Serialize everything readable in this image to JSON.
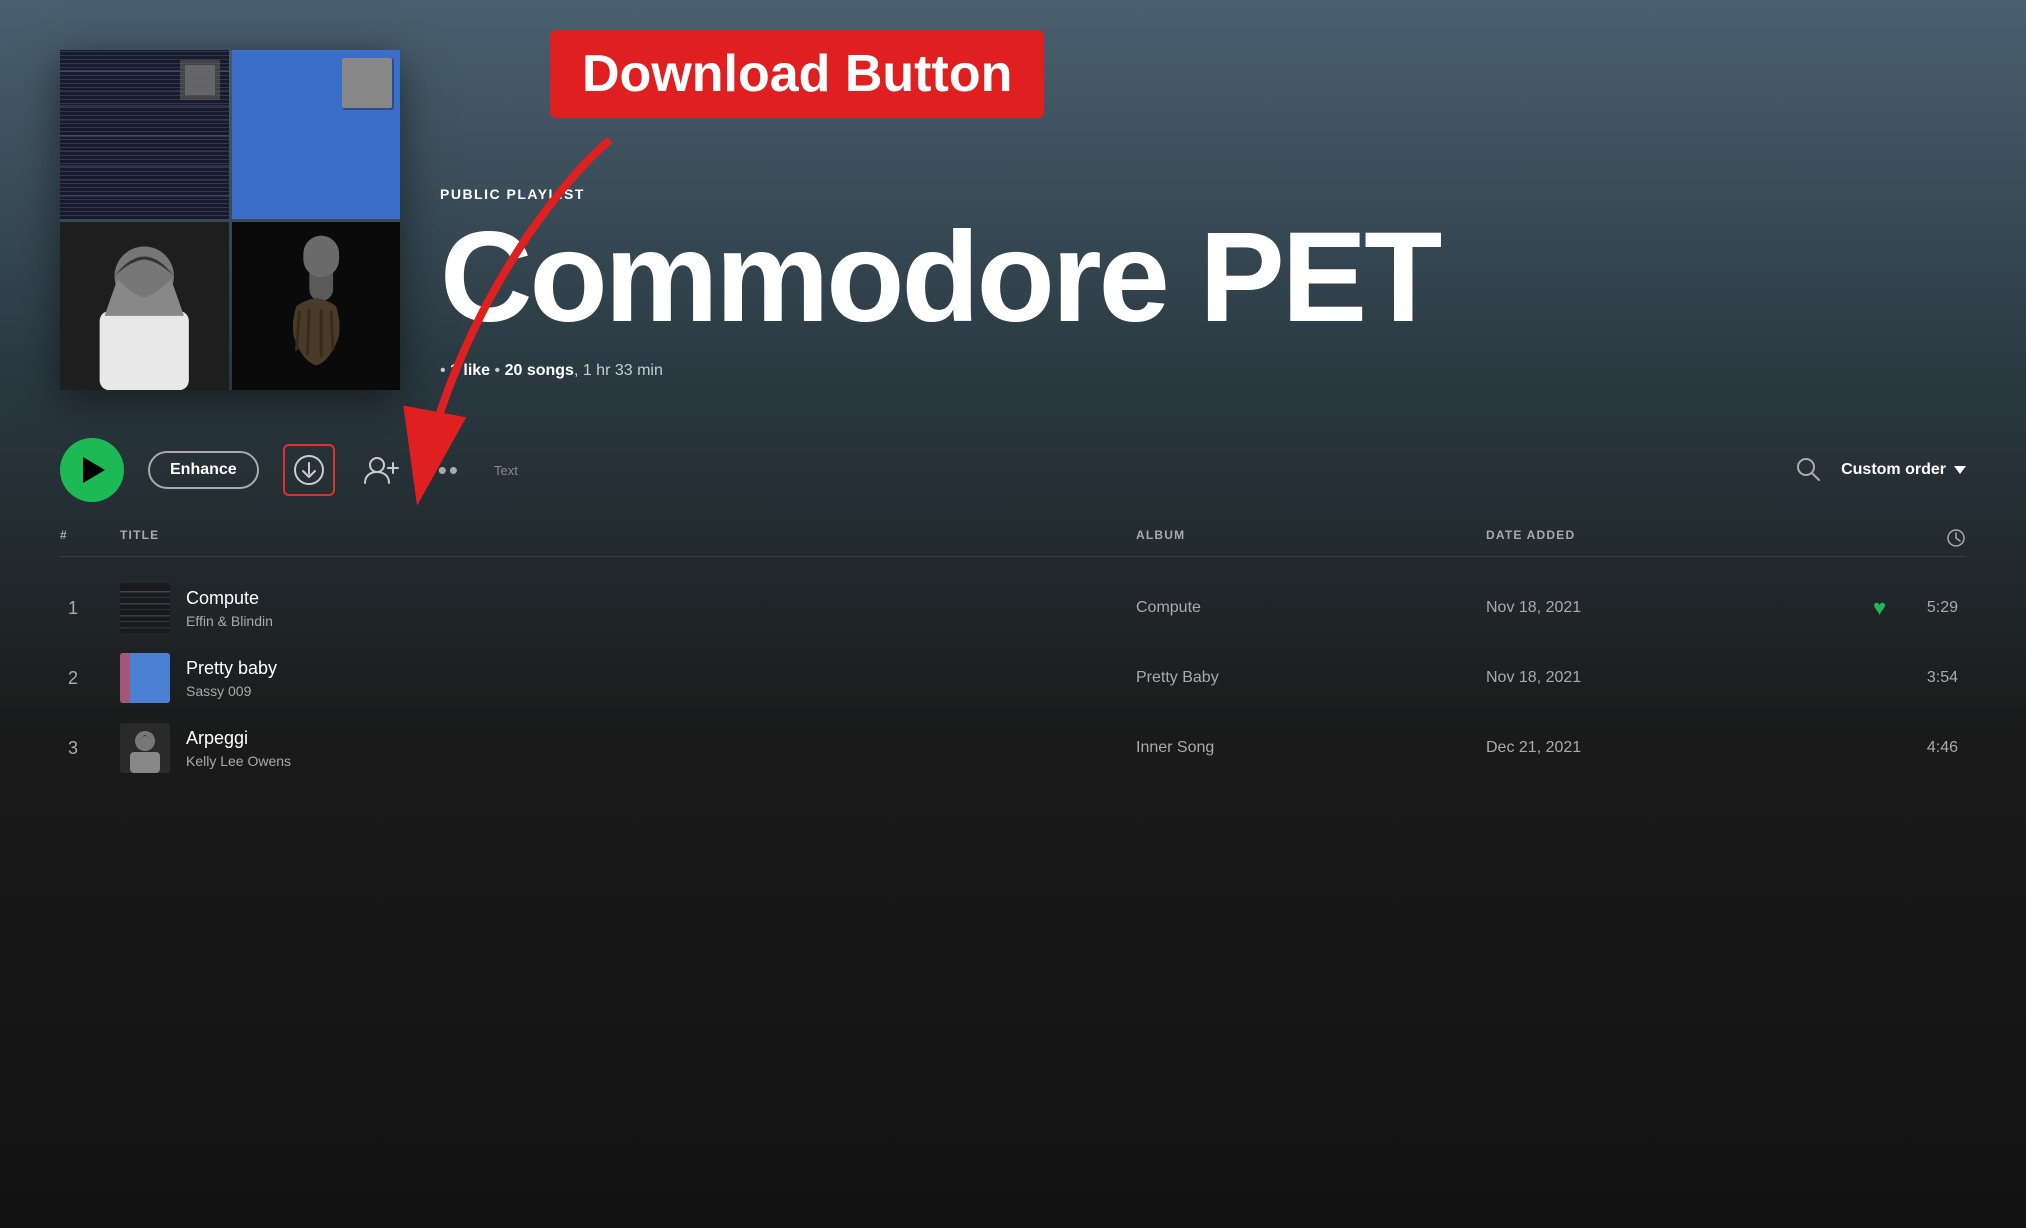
{
  "annotation": {
    "label": "Download Button",
    "bg_color": "#e02020"
  },
  "playlist": {
    "type": "PUBLIC PLAYLIST",
    "title": "Commodore PET",
    "likes": "1 like",
    "song_count": "20 songs",
    "duration": "1 hr 33 min"
  },
  "controls": {
    "enhance_label": "Enhance",
    "text_label": "Text",
    "custom_order_label": "Custom order"
  },
  "table_headers": {
    "hash": "#",
    "title": "TITLE",
    "album": "ALBUM",
    "date_added": "DATE ADDED"
  },
  "tracks": [
    {
      "num": "1",
      "name": "Compute",
      "artist": "Effin & Blindin",
      "album": "Compute",
      "date_added": "Nov 18, 2021",
      "duration": "5:29",
      "liked": true,
      "thumb_type": "lines"
    },
    {
      "num": "2",
      "name": "Pretty baby",
      "artist": "Sassy 009",
      "album": "Pretty Baby",
      "date_added": "Nov 18, 2021",
      "duration": "3:54",
      "liked": false,
      "thumb_type": "blue"
    },
    {
      "num": "3",
      "name": "Arpeggi",
      "artist": "Kelly Lee Owens",
      "album": "Inner Song",
      "date_added": "Dec 21, 2021",
      "duration": "4:46",
      "liked": false,
      "thumb_type": "person"
    }
  ]
}
